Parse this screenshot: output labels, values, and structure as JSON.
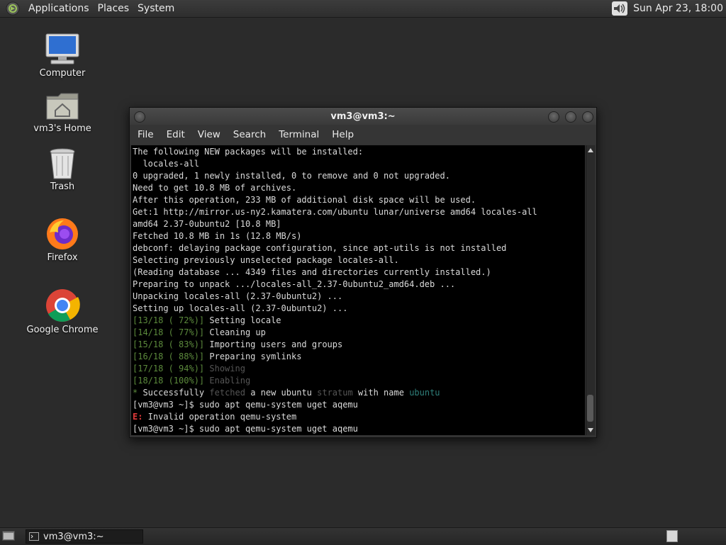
{
  "top_panel": {
    "menus": [
      "Applications",
      "Places",
      "System"
    ],
    "clock": "Sun Apr 23, 18:00"
  },
  "desktop_icons": [
    {
      "label": "Computer",
      "icon": "computer-icon"
    },
    {
      "label": "vm3's Home",
      "icon": "home-folder-icon"
    },
    {
      "label": "Trash",
      "icon": "trash-icon"
    },
    {
      "label": "Firefox",
      "icon": "firefox-icon"
    },
    {
      "label": "Google Chrome",
      "icon": "chrome-icon"
    }
  ],
  "terminal": {
    "title": "vm3@vm3:~",
    "menu": [
      "File",
      "Edit",
      "View",
      "Search",
      "Terminal",
      "Help"
    ],
    "lines": [
      "The following NEW packages will be installed:",
      "  locales-all",
      "0 upgraded, 1 newly installed, 0 to remove and 0 not upgraded.",
      "Need to get 10.8 MB of archives.",
      "After this operation, 233 MB of additional disk space will be used.",
      "Get:1 http://mirror.us-ny2.kamatera.com/ubuntu lunar/universe amd64 locales-all",
      "amd64 2.37-0ubuntu2 [10.8 MB]",
      "Fetched 10.8 MB in 1s (12.8 MB/s)",
      "debconf: delaying package configuration, since apt-utils is not installed",
      "Selecting previously unselected package locales-all.",
      "(Reading database ... 4349 files and directories currently installed.)",
      "Preparing to unpack .../locales-all_2.37-0ubuntu2_amd64.deb ...",
      "Unpacking locales-all (2.37-0ubuntu2) ...",
      "Setting up locales-all (2.37-0ubuntu2) ...",
      "[13/18 ( 72%)] Setting locale",
      "[14/18 ( 77%)] Cleaning up",
      "[15/18 ( 83%)] Importing users and groups",
      "[16/18 ( 88%)] Preparing symlinks",
      "[17/18 ( 94%)] Showing",
      "[18/18 (100%)] Enabling",
      "* Successfully fetched a new ubuntu stratum with name ubuntu",
      "[vm3@vm3 ~]$ sudo apt qemu-system uget aqemu",
      "E: Invalid operation qemu-system",
      "[vm3@vm3 ~]$ sudo apt qemu-system uget aqemu"
    ]
  },
  "taskbar": {
    "window_button": "vm3@vm3:~"
  },
  "colors": {
    "progress_green": "#5c8a3c",
    "dim_gray": "#555555",
    "teal": "#2f7f7a",
    "error_red": "#e23a3a"
  }
}
